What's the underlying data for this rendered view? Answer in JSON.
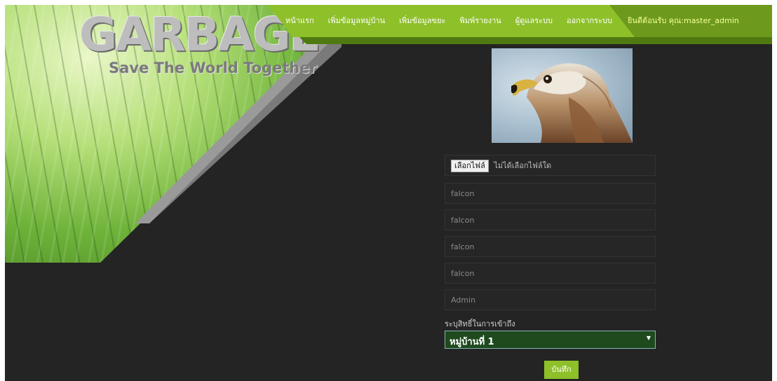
{
  "brand": {
    "logo": "GARBAGE",
    "tagline": "Save The World Together"
  },
  "nav": {
    "items": [
      "หน้าแรก",
      "เพิ่มข้อมูลหมู่บ้าน",
      "เพิ่มข้อมูลขยะ",
      "พิมพ์รายงาน",
      "ผู้ดูแลระบบ",
      "ออกจากระบบ"
    ],
    "welcome": "ยินดีต้อนรับ คุณ:master_admin"
  },
  "form": {
    "file": {
      "button_label": "เลือกไฟล์",
      "status": "ไม่ได้เลือกไฟล์ใด"
    },
    "fields": [
      {
        "value": "falcon"
      },
      {
        "value": "falcon"
      },
      {
        "value": "falcon"
      },
      {
        "value": "falcon"
      },
      {
        "value": "Admin"
      }
    ],
    "access_label": "ระบุสิทธิ์ในการเข้าถึง",
    "access_selected": "หมู่บ้านที่ 1",
    "save_label": "บันทึก"
  }
}
